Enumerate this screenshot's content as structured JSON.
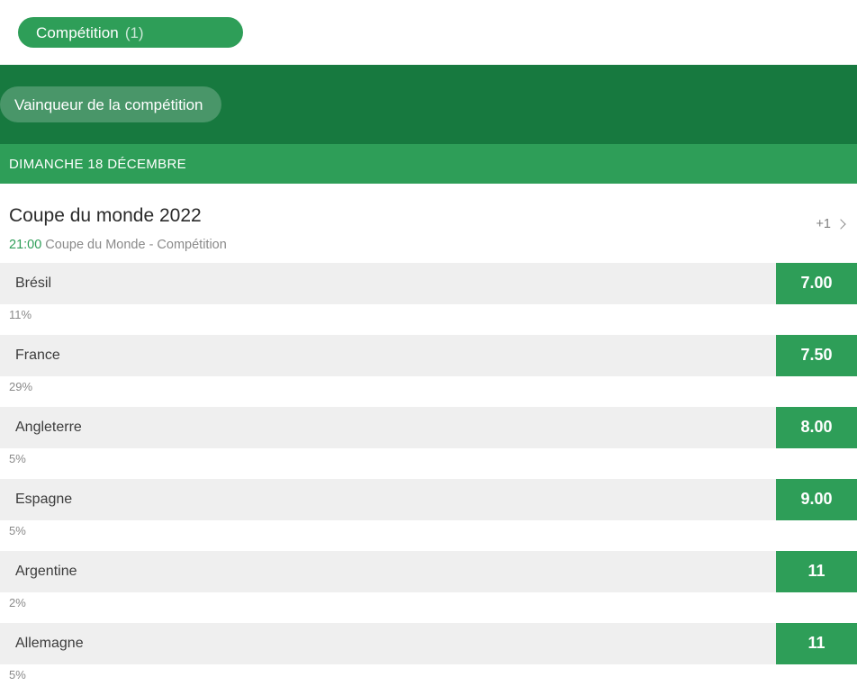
{
  "tabbar": {
    "tabs": [
      {
        "label": "Compétition",
        "count": "(1)",
        "active": true
      }
    ]
  },
  "market_band": {
    "market_label": "Vainqueur de la compétition"
  },
  "date_band": {
    "label": "DIMANCHE 18 DÉCEMBRE"
  },
  "event": {
    "title": "Coupe du monde 2022",
    "time": "21:00",
    "meta": "Coupe du Monde - Compétition",
    "more_label": "+1",
    "more_icon": "chevron-right-icon"
  },
  "selections": [
    {
      "name": "Brésil",
      "odds": "7.00",
      "percent_label": "11%",
      "percent": 11
    },
    {
      "name": "France",
      "odds": "7.50",
      "percent_label": "29%",
      "percent": 29
    },
    {
      "name": "Angleterre",
      "odds": "8.00",
      "percent_label": "5%",
      "percent": 5
    },
    {
      "name": "Espagne",
      "odds": "9.00",
      "percent_label": "5%",
      "percent": 5
    },
    {
      "name": "Argentine",
      "odds": "11",
      "percent_label": "2%",
      "percent": 2
    },
    {
      "name": "Allemagne",
      "odds": "11",
      "percent_label": "5%",
      "percent": 5
    }
  ],
  "colors": {
    "brand_green": "#2e9e58",
    "brand_green_dark": "#17793f",
    "row_gray": "#efefef",
    "bar_orange": "#f7a400",
    "muted_text": "#8a8a8a"
  }
}
